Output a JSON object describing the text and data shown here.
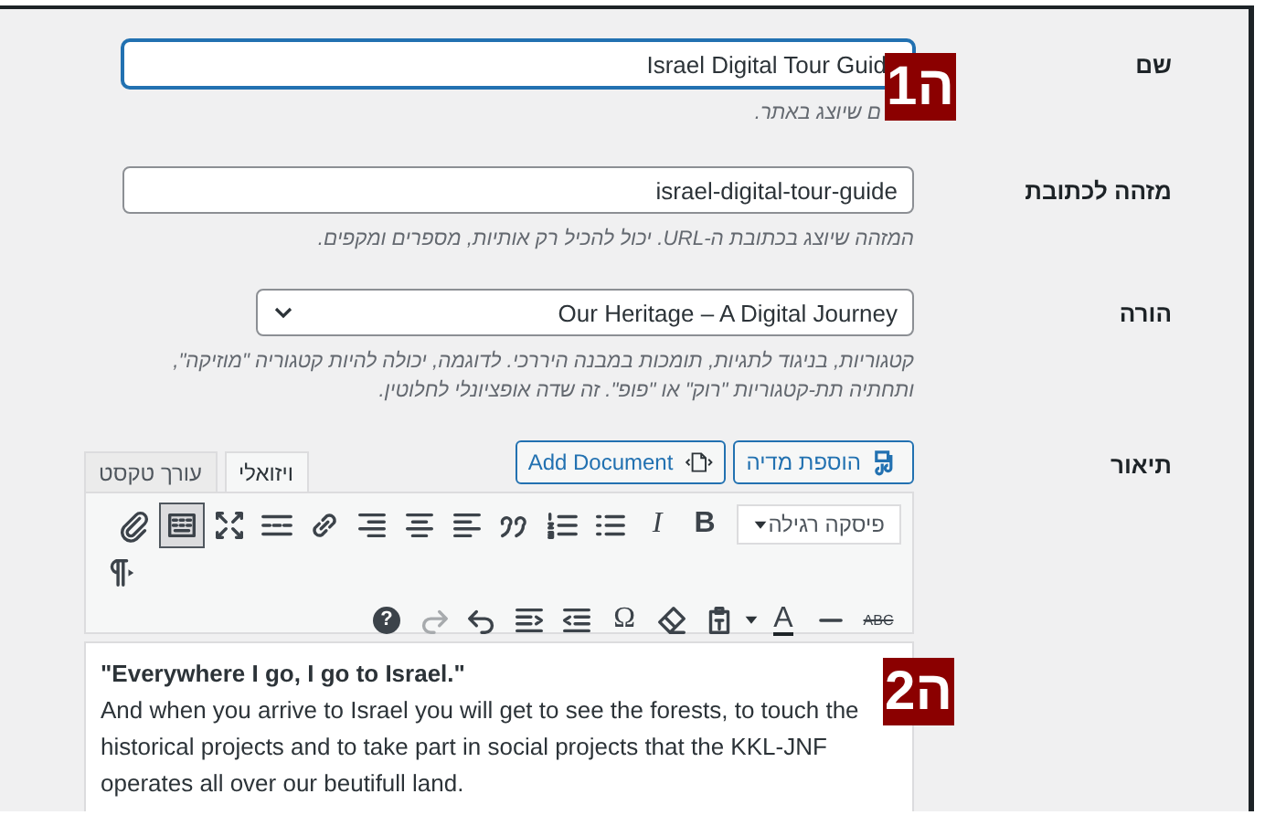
{
  "fields": [
    {
      "kind": "input",
      "label": "שם",
      "value": "Israel Digital Tour Guid",
      "focused": true,
      "description": "ם שיוצג באתר."
    },
    {
      "kind": "input",
      "label": "מזהה לכתובת",
      "value": "israel-digital-tour-guide",
      "focused": false,
      "description": "המזהה שיוצג בכתובת ה-URL. יכול להכיל רק אותיות, מספרים ומקפים."
    },
    {
      "kind": "select",
      "label": "הורה",
      "value": "Our Heritage – A Digital Journey",
      "focused": false,
      "description": "קטגוריות, בניגוד לתגיות, תומכות במבנה היררכי. לדוגמה, יכולה להיות קטגוריה \"מוזיקה\", ותחתיה תת-קטגוריות \"רוק\" או \"פופ\". זה שדה אופציונלי לחלוטין."
    }
  ],
  "description_editor": {
    "label": "תיאור",
    "media_buttons": [
      {
        "kind": "media",
        "label": "הוספת מדיה"
      },
      {
        "kind": "document",
        "label": "Add Document"
      }
    ],
    "tabs": [
      {
        "label": "ויזואלי",
        "selected": true
      },
      {
        "label": "עורך טקסט",
        "selected": false
      }
    ],
    "format_select": "פיסקה רגילה",
    "toolbar_rows": [
      [
        {
          "kind": "bold",
          "label": "B",
          "pressed": false,
          "disabled": false
        },
        {
          "kind": "italic",
          "label": "I",
          "pressed": false,
          "disabled": false
        },
        {
          "kind": "bullist",
          "pressed": false,
          "disabled": false
        },
        {
          "kind": "numlist",
          "pressed": false,
          "disabled": false
        },
        {
          "kind": "quote",
          "pressed": false,
          "disabled": false
        },
        {
          "kind": "alignleft",
          "pressed": false,
          "disabled": false
        },
        {
          "kind": "aligncenter",
          "pressed": false,
          "disabled": false
        },
        {
          "kind": "alignright",
          "pressed": false,
          "disabled": false
        },
        {
          "kind": "link",
          "pressed": false,
          "disabled": false
        },
        {
          "kind": "more",
          "pressed": false,
          "disabled": false
        },
        {
          "kind": "fullscreen",
          "pressed": false,
          "disabled": false
        },
        {
          "kind": "toolbar",
          "pressed": true,
          "disabled": false
        },
        {
          "kind": "attach",
          "pressed": false,
          "disabled": false
        }
      ],
      [
        {
          "kind": "ltr",
          "pressed": false,
          "disabled": false
        }
      ],
      [
        {
          "kind": "strike",
          "label": "ABC",
          "pressed": false,
          "disabled": false
        },
        {
          "kind": "hr",
          "pressed": false,
          "disabled": false
        },
        {
          "kind": "forecolor",
          "label": "A",
          "pressed": false,
          "disabled": false
        },
        {
          "kind": "paste",
          "pressed": false,
          "disabled": false
        },
        {
          "kind": "eraser",
          "pressed": false,
          "disabled": false
        },
        {
          "kind": "charmap",
          "label": "Ω",
          "pressed": false,
          "disabled": false
        },
        {
          "kind": "outdent",
          "pressed": false,
          "disabled": false
        },
        {
          "kind": "indent",
          "pressed": false,
          "disabled": false
        },
        {
          "kind": "undo",
          "pressed": false,
          "disabled": false
        },
        {
          "kind": "redo",
          "pressed": false,
          "disabled": true
        },
        {
          "kind": "help",
          "label": "?",
          "pressed": false,
          "disabled": false
        }
      ]
    ],
    "content_heading": "\"Everywhere I go, I go to Israel.\"",
    "content_paragraph": "And when you arrive to Israel you will get to see the forests, to touch the historical projects and to take part in social projects that the KKL-JNF operates all over our beutifull land."
  },
  "badges": [
    {
      "number": "1",
      "letter": "ה"
    },
    {
      "number": "2",
      "letter": "ה"
    }
  ]
}
